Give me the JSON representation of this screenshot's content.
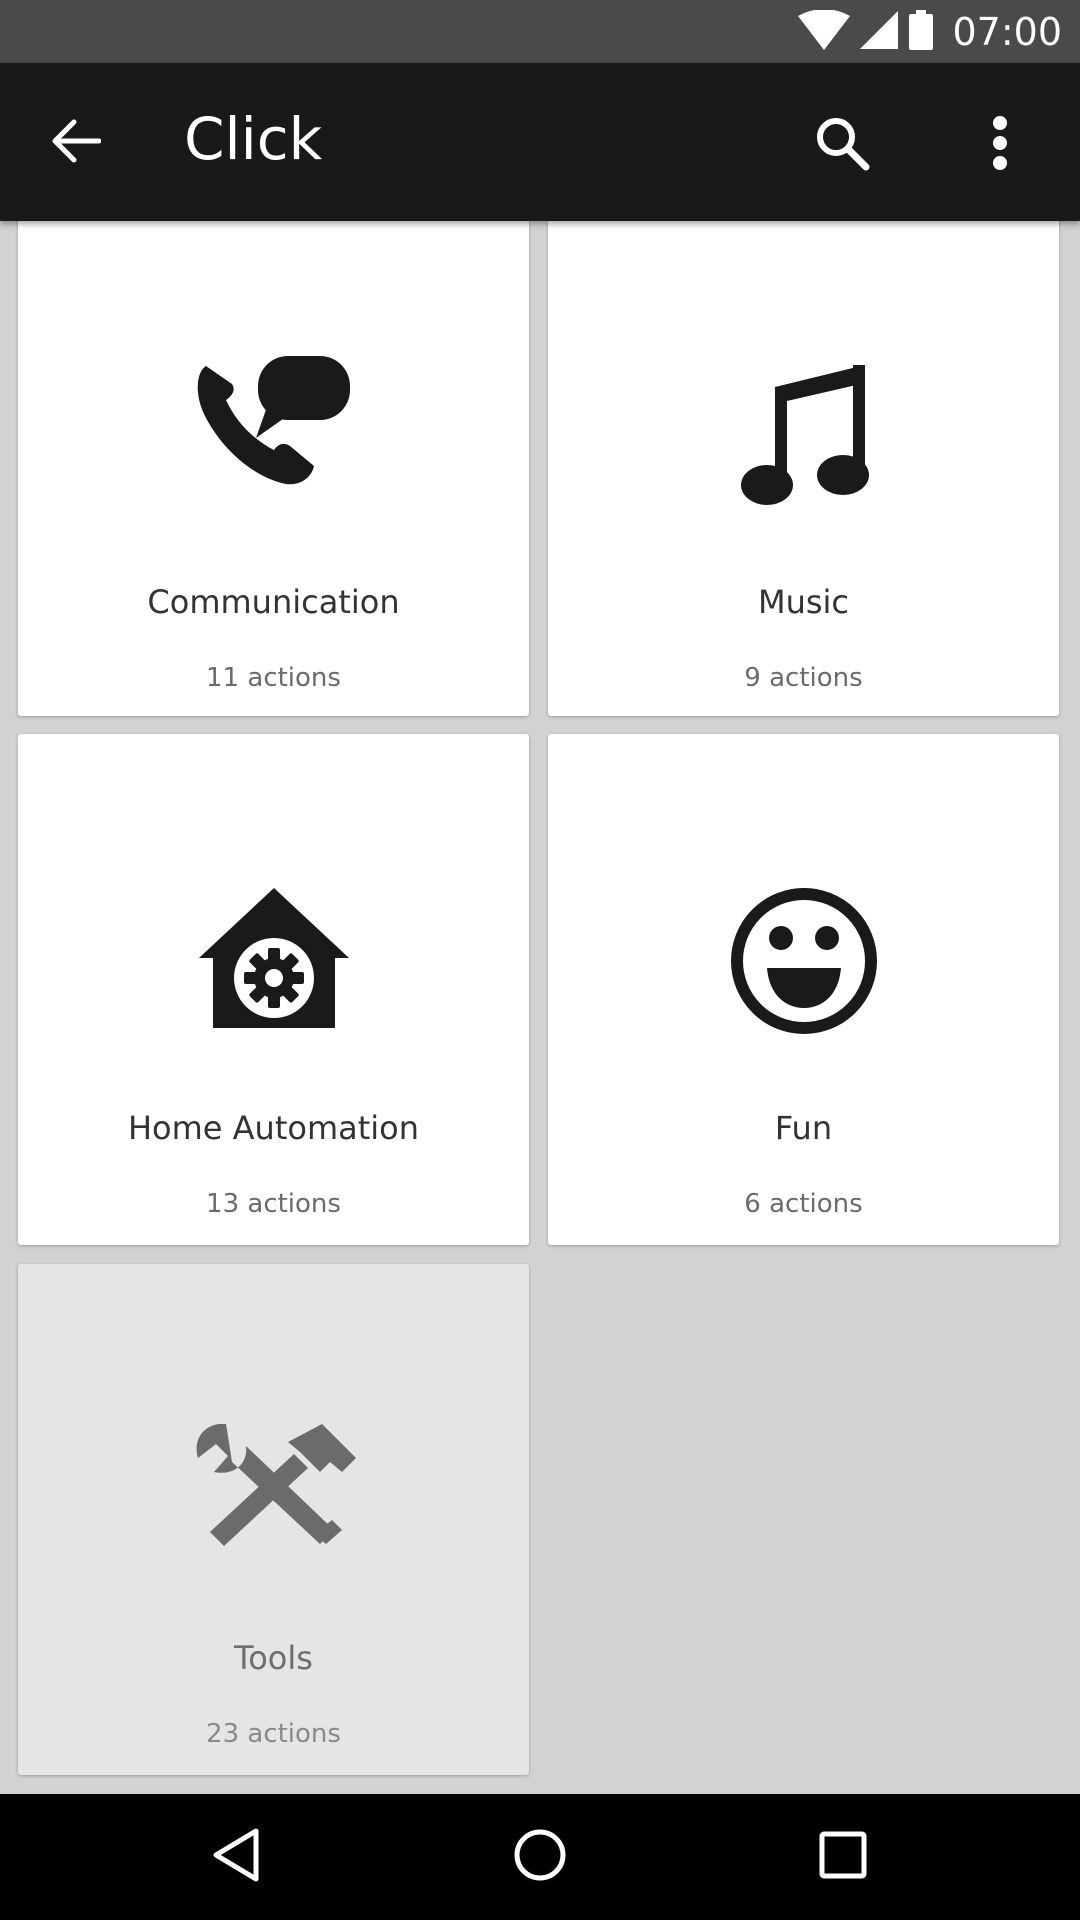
{
  "status_bar": {
    "time": "07:00",
    "icons": [
      "wifi-icon",
      "cell-signal-icon",
      "battery-icon"
    ]
  },
  "app_bar": {
    "title": "Click",
    "icons": [
      "arrow-back-icon",
      "search-icon",
      "more-vert-icon"
    ]
  },
  "categories": [
    {
      "name": "Communication",
      "count": "11 actions",
      "icon": "phone-chat-icon"
    },
    {
      "name": "Music",
      "count": "9 actions",
      "icon": "music-note-icon"
    },
    {
      "name": "Home Automation",
      "count": "13 actions",
      "icon": "home-gear-icon"
    },
    {
      "name": "Fun",
      "count": "6 actions",
      "icon": "smiley-icon"
    },
    {
      "name": "Tools",
      "count": "23 actions",
      "icon": "tools-icon"
    }
  ],
  "nav_bar": {
    "icons": [
      "nav-back-icon",
      "nav-home-icon",
      "nav-recents-icon"
    ]
  },
  "colors": {
    "status_bar": "#4a4a4a",
    "app_bar": "#181919",
    "background": "#d2d2d2",
    "card": "#ffffff",
    "card_pressed": "#e5e5e5",
    "icon": "#1a1a1a"
  }
}
